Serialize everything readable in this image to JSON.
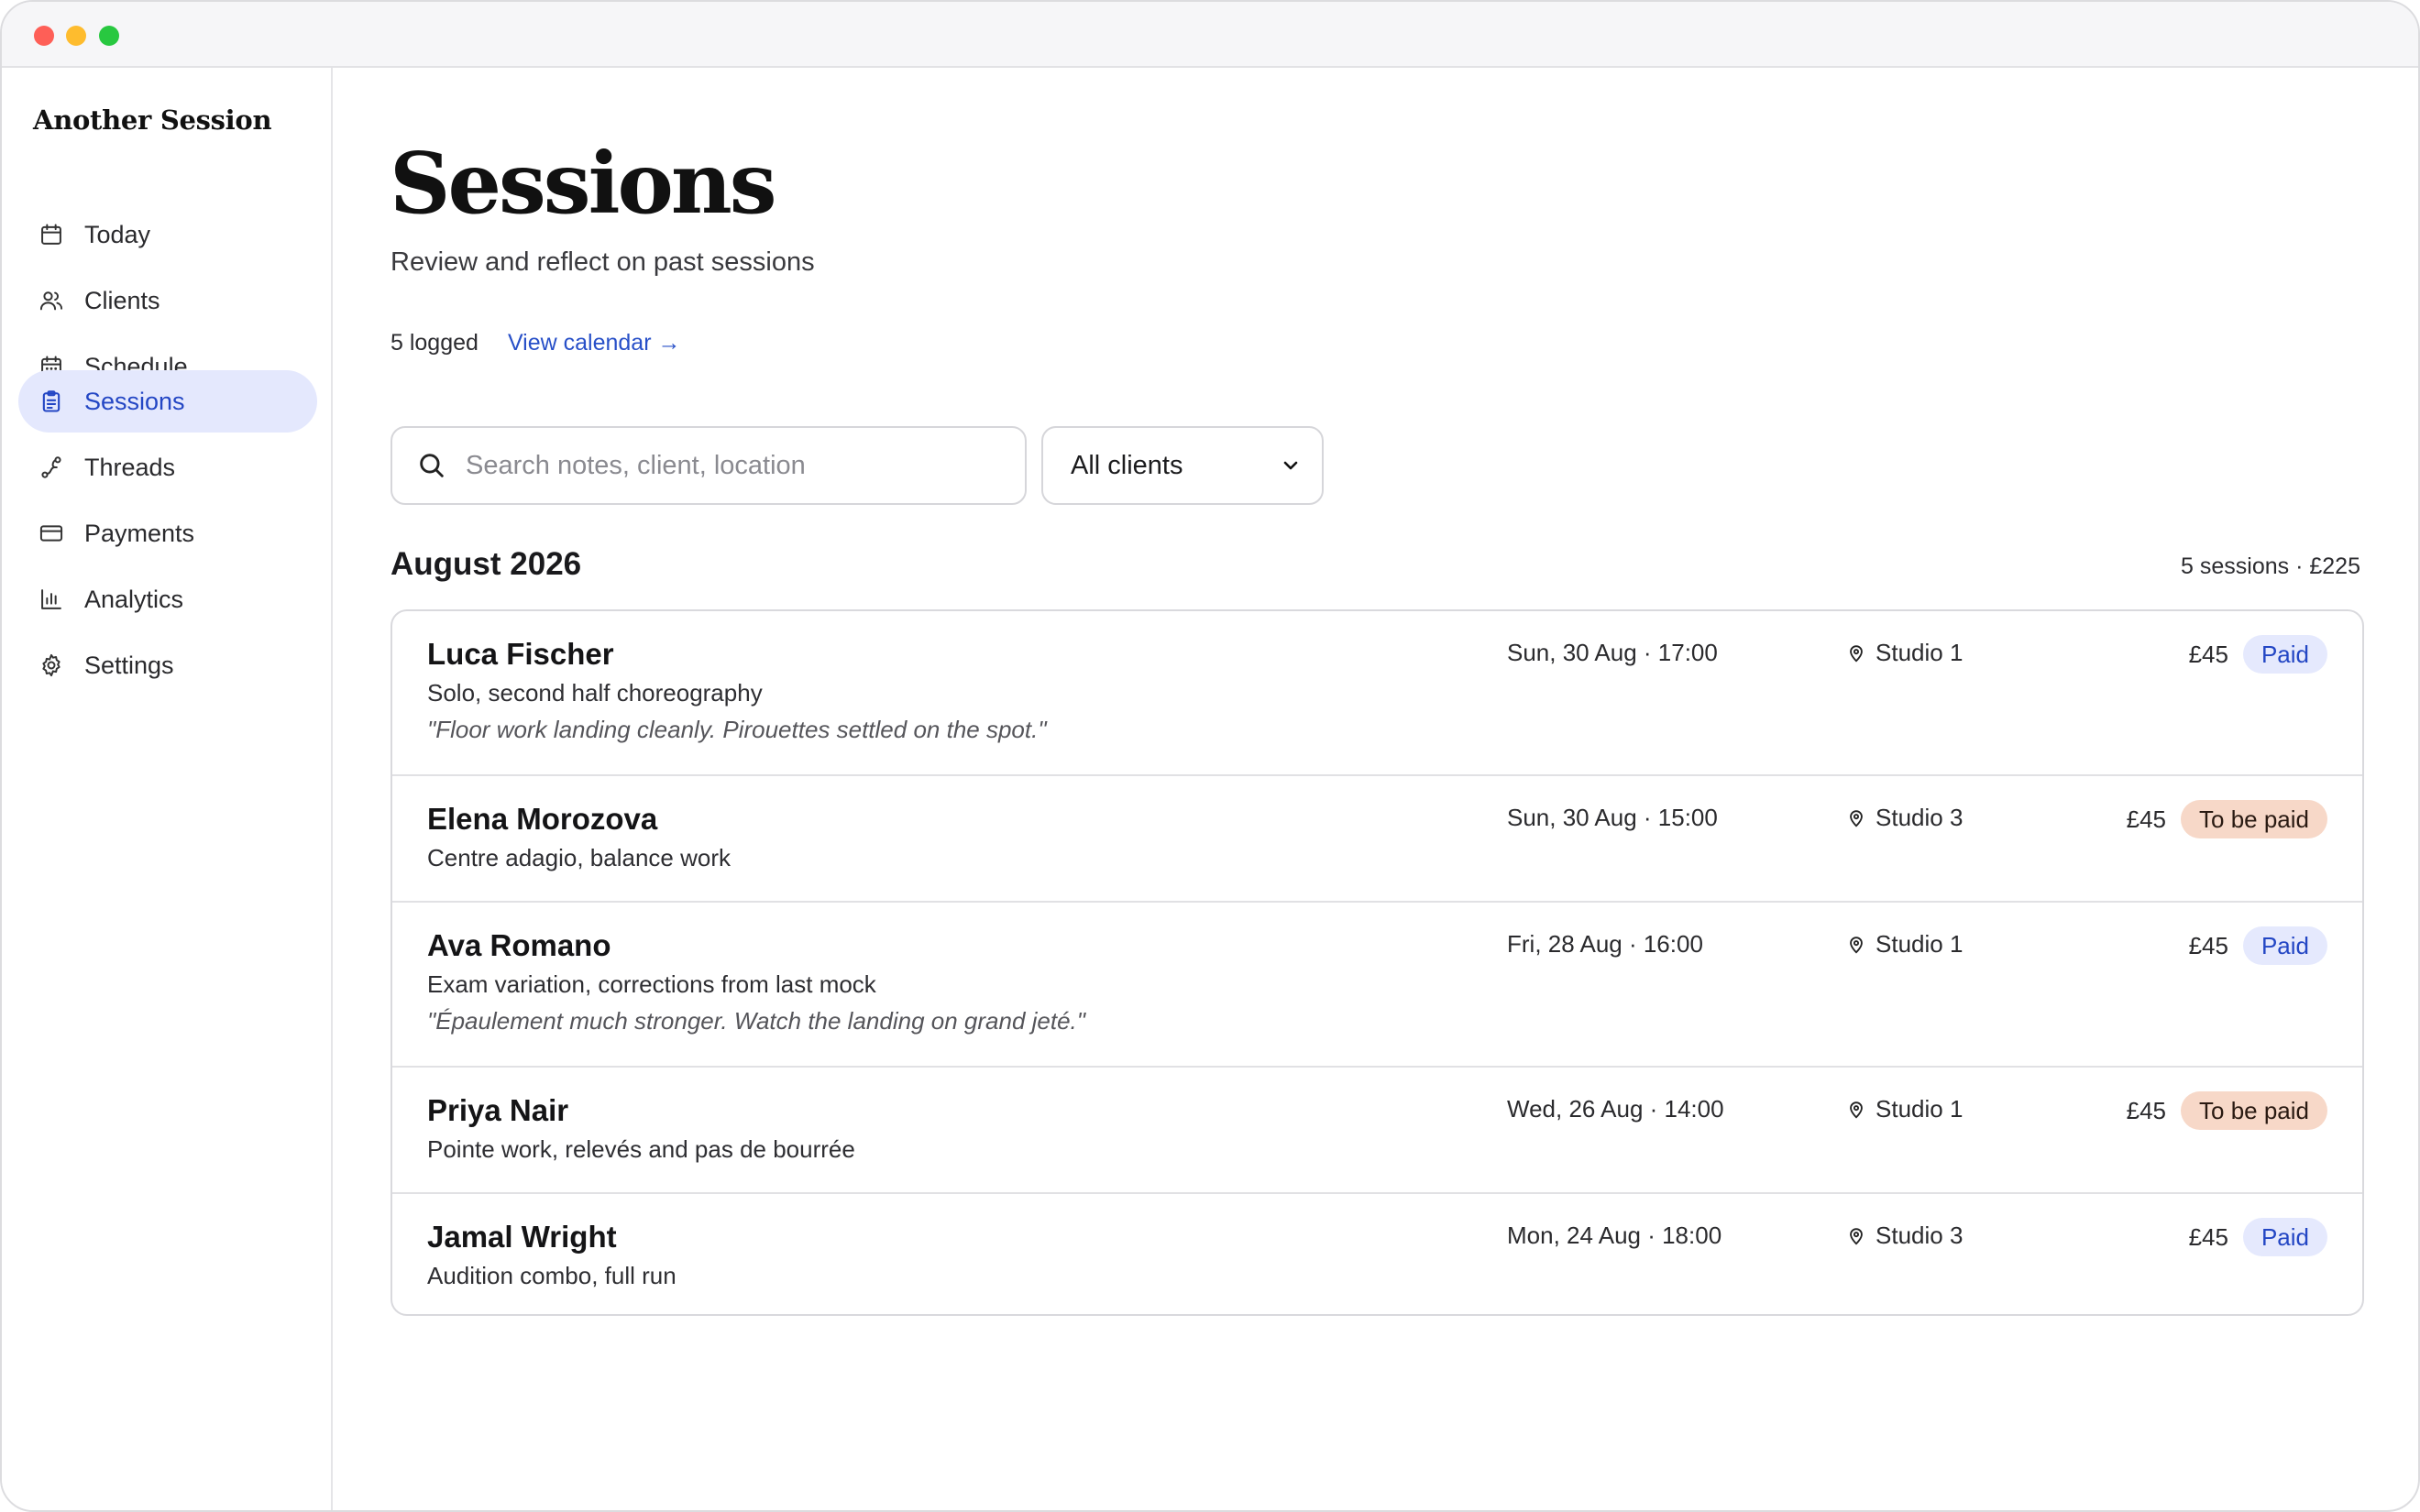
{
  "app": {
    "name": "Another Session"
  },
  "sidebar": {
    "items": [
      {
        "label": "Today",
        "icon": "calendar-icon",
        "active": false
      },
      {
        "label": "Clients",
        "icon": "users-icon",
        "active": false
      },
      {
        "label": "Schedule",
        "icon": "calendar-grid-icon",
        "active": false
      },
      {
        "label": "Sessions",
        "icon": "clipboard-icon",
        "active": true
      },
      {
        "label": "Threads",
        "icon": "threads-icon",
        "active": false
      },
      {
        "label": "Payments",
        "icon": "card-icon",
        "active": false
      },
      {
        "label": "Analytics",
        "icon": "bar-chart-icon",
        "active": false
      },
      {
        "label": "Settings",
        "icon": "gear-icon",
        "active": false
      }
    ]
  },
  "header": {
    "title": "Sessions",
    "subtitle": "Review and reflect on past sessions",
    "count": "5 logged",
    "calendar_link": "View calendar →"
  },
  "filters": {
    "search_placeholder": "Search notes, client, location",
    "client_select": "All clients"
  },
  "group": {
    "month": "August 2026",
    "summary": "5 sessions · £225"
  },
  "sessions": [
    {
      "client": "Luca Fischer",
      "description": "Solo, second half choreography",
      "note": "\"Floor work landing cleanly. Pirouettes settled on the spot.\"",
      "datetime": "Sun, 30 Aug · 17:00",
      "location": "Studio 1",
      "price": "£45",
      "status": "Paid"
    },
    {
      "client": "Elena Morozova",
      "description": "Centre adagio, balance work",
      "note": "",
      "datetime": "Sun, 30 Aug · 15:00",
      "location": "Studio 3",
      "price": "£45",
      "status": "To be paid"
    },
    {
      "client": "Ava Romano",
      "description": "Exam variation, corrections from last mock",
      "note": "\"Épaulement much stronger. Watch the landing on grand jeté.\"",
      "datetime": "Fri, 28 Aug · 16:00",
      "location": "Studio 1",
      "price": "£45",
      "status": "Paid"
    },
    {
      "client": "Priya Nair",
      "description": "Pointe work, relevés and pas de bourrée",
      "note": "",
      "datetime": "Wed, 26 Aug · 14:00",
      "location": "Studio 1",
      "price": "£45",
      "status": "To be paid"
    },
    {
      "client": "Jamal Wright",
      "description": "Audition combo, full run",
      "note": "",
      "datetime": "Mon, 24 Aug · 18:00",
      "location": "Studio 3",
      "price": "£45",
      "status": "Paid"
    }
  ],
  "colors": {
    "accent": "#2346c4",
    "active_nav_bg": "#e4e8fd",
    "paid_badge_bg": "#e5e9fd",
    "due_badge_bg": "#f7d8c8"
  }
}
